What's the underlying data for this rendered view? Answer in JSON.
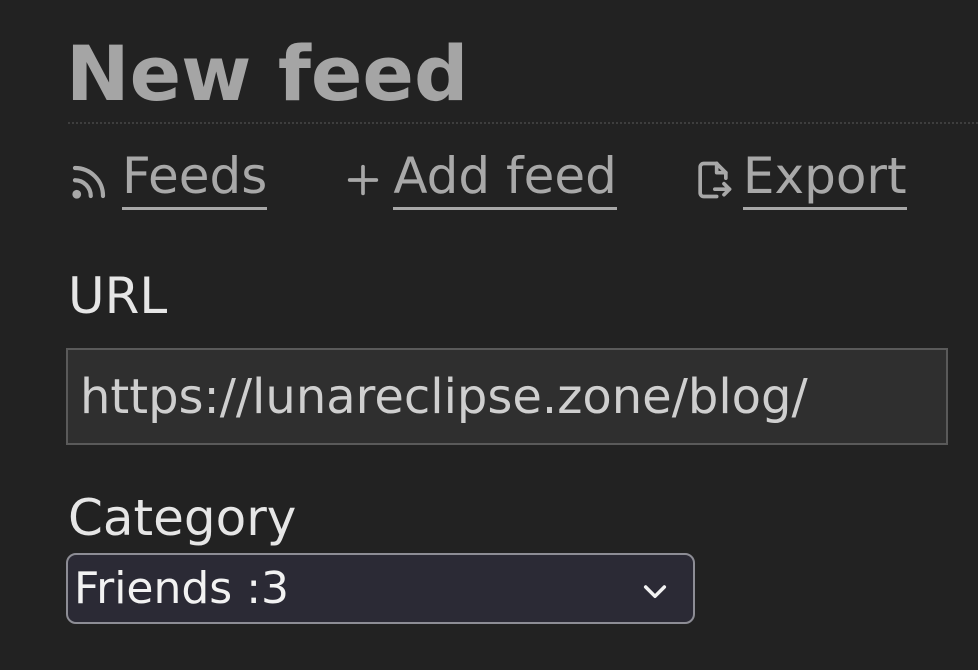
{
  "page": {
    "title": "New feed"
  },
  "nav": {
    "feeds": {
      "label": "Feeds",
      "icon": "rss-icon"
    },
    "add_feed": {
      "label": "Add feed",
      "icon": "plus-icon"
    },
    "export": {
      "label": "Export",
      "icon": "file-export-icon"
    }
  },
  "form": {
    "url": {
      "label": "URL",
      "value": "https://lunareclipse.zone/blog/"
    },
    "category": {
      "label": "Category",
      "selected": "Friends :3",
      "icon": "chevron-down-icon"
    }
  },
  "colors": {
    "background": "#222222",
    "title": "#a5a5a5",
    "link": "#a8a8a8",
    "label": "#e6e6e6",
    "input_bg": "#2f2f2f",
    "select_bg": "#2b2a35"
  }
}
